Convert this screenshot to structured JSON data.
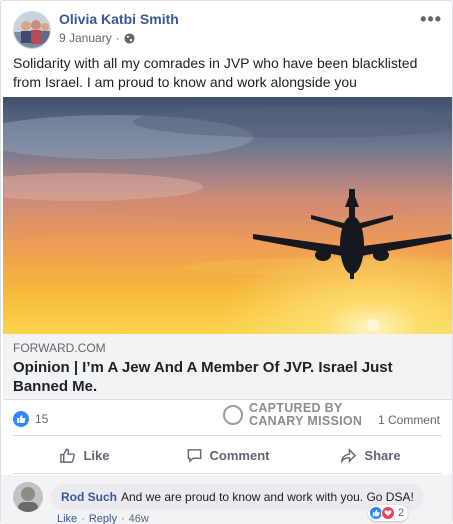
{
  "post": {
    "author": "Olivia Katbi Smith",
    "date": "9 January",
    "separator": "·",
    "privacy_icon": "globe-icon",
    "more_icon": "more-options-icon",
    "more_label": "•••",
    "text": "Solidarity with all my comrades in JVP who have been blacklisted from Israel. I am proud to know and work alongside you"
  },
  "link": {
    "domain": "FORWARD.COM",
    "title": "Opinion | I’m A Jew And A Member Of JVP. Israel Just Banned Me."
  },
  "stats": {
    "like_count": "15",
    "comment_count": "1 Comment"
  },
  "watermark": {
    "line1": "CAPTURED BY",
    "line2": "CANARY MISSION"
  },
  "actions": {
    "like": "Like",
    "comment": "Comment",
    "share": "Share"
  },
  "comment": {
    "author": "Rod Such",
    "text": "And we are proud to know and work with you. Go DSA!",
    "like_link": "Like",
    "reply_link": "Reply",
    "separator": "·",
    "time": "46w",
    "reaction_count": "2"
  },
  "colors": {
    "link_blue": "#385898",
    "like_blue": "#2d88ff",
    "love_red": "#f33e58",
    "gray_text": "#606770"
  }
}
